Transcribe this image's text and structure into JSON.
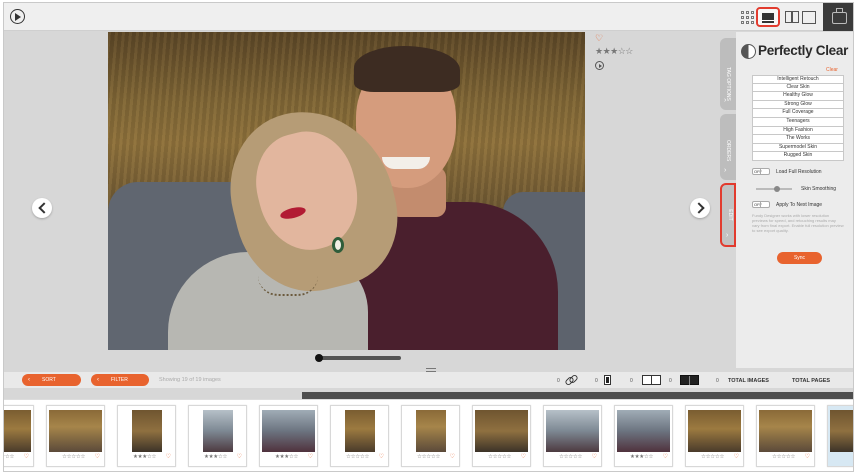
{
  "toolbar": {
    "icons": [
      "play-circle-icon",
      "grid-view-icon",
      "two-by-two-view-icon",
      "split-view-icon",
      "single-view-icon",
      "app-logo-icon"
    ],
    "selected_view": "two-by-two"
  },
  "viewer": {
    "heart": "♡",
    "rating": "★★★☆☆",
    "rating_value": 3,
    "rating_max": 5
  },
  "tabs": {
    "tag_options": "TAG OPTIONS",
    "orders": "ORDERS",
    "edit": "EDIT",
    "chevron": "›"
  },
  "panel": {
    "title": "Perfectly Clear",
    "clear_label": "Clear",
    "presets": [
      "Intelligent Retouch",
      "Clear Skin",
      "Healthy Glow",
      "Strong Glow",
      "Full Coverage",
      "Teenagers",
      "High Fashion",
      "The Works",
      "Supermodel Skin",
      "Rugged Skin"
    ],
    "load_full_resolution": {
      "state": "OFF",
      "label": "Load Full Resolution"
    },
    "skin_smoothing": {
      "label": "Skin Smoothing"
    },
    "apply_to_next": {
      "state": "OFF",
      "label": "Apply To Next Image"
    },
    "description": "Fundy Designer works with lower resolution previews for speed, and retouching results may vary from final export. Enable full resolution preview to see export quality.",
    "sync_label": "Sync"
  },
  "filterbar": {
    "sort_label": "SORT",
    "filter_label": "FILTER",
    "chevron": "‹",
    "showing_text": "Showing 19 of 19 images",
    "counts": [
      "0",
      "0",
      "0",
      "0",
      "0"
    ],
    "total_images_label": "TOTAL IMAGES",
    "total_pages_label": "TOTAL PAGES"
  },
  "filmstrip": {
    "colors": {
      "accent": "#e8632e",
      "highlight": "#e23b2e",
      "selected_bg": "#d7e8f3"
    },
    "items": [
      {
        "stars": "☆☆☆☆☆",
        "heart": "♡",
        "style": "landscape"
      },
      {
        "stars": "☆☆☆☆☆",
        "heart": "♡",
        "style": "landscape"
      },
      {
        "stars": "★★★☆☆",
        "heart": "♡",
        "style": "portrait"
      },
      {
        "stars": "★★★☆☆",
        "heart": "♡",
        "style": "portrait"
      },
      {
        "stars": "★★★☆☆",
        "heart": "♡",
        "style": "landscape"
      },
      {
        "stars": "☆☆☆☆☆",
        "heart": "♡",
        "style": "portrait"
      },
      {
        "stars": "☆☆☆☆☆",
        "heart": "♡",
        "style": "portrait"
      },
      {
        "stars": "☆☆☆☆☆",
        "heart": "♡",
        "style": "landscape"
      },
      {
        "stars": "☆☆☆☆☆",
        "heart": "♡",
        "style": "landscape"
      },
      {
        "stars": "★★★☆☆",
        "heart": "♡",
        "style": "landscape"
      },
      {
        "stars": "☆☆☆☆☆",
        "heart": "♡",
        "style": "landscape"
      },
      {
        "stars": "☆☆☆☆☆",
        "heart": "♡",
        "style": "landscape"
      },
      {
        "stars": "",
        "heart": "",
        "style": "landscape"
      }
    ]
  }
}
